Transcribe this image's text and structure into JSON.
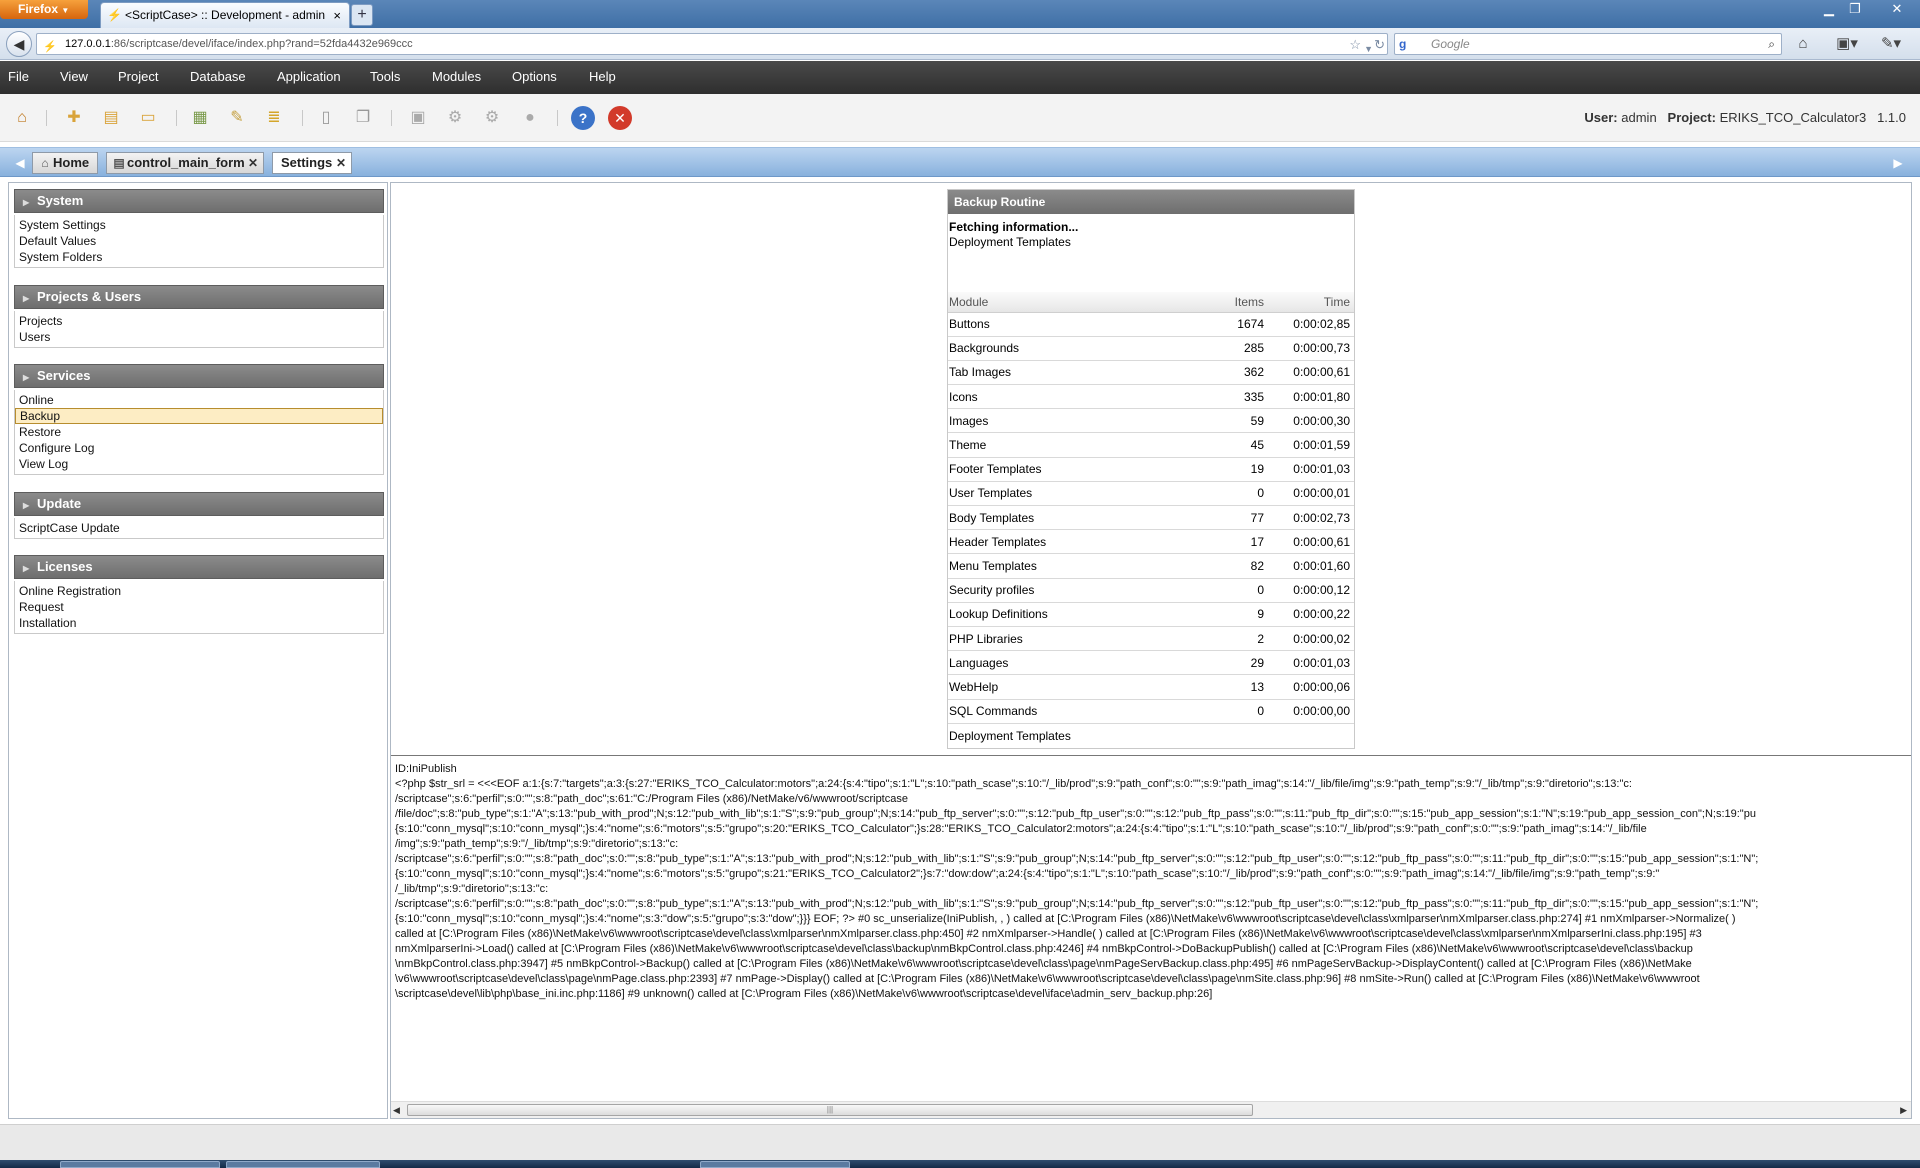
{
  "browser": {
    "menu_label": "Firefox",
    "tab_title": "<ScriptCase> :: Development - admin",
    "new_tab": "+",
    "url_host": "127.0.0.1",
    "url_rest": ":86/scriptcase/devel/iface/index.php?rand=52fda4432e969ccc",
    "search_placeholder": "Google"
  },
  "menu": [
    "File",
    "View",
    "Project",
    "Database",
    "Application",
    "Tools",
    "Modules",
    "Options",
    "Help"
  ],
  "user": {
    "user_label": "User:",
    "user_name": "admin",
    "project_label": "Project:",
    "project_name": "ERIKS_TCO_Calculator3",
    "version": "1.1.0"
  },
  "tabs": [
    {
      "label": "Home",
      "icon": "home-icon"
    },
    {
      "label": "control_main_form",
      "icon": "form-icon"
    },
    {
      "label": "Settings",
      "icon": "none"
    }
  ],
  "sidebar": {
    "sections": [
      {
        "title": "System",
        "items": [
          "System Settings",
          "Default Values",
          "System Folders"
        ]
      },
      {
        "title": "Projects & Users",
        "items": [
          "Projects",
          "Users"
        ]
      },
      {
        "title": "Services",
        "items": [
          "Online",
          "Backup",
          "Restore",
          "Configure Log",
          "View Log"
        ]
      },
      {
        "title": "Update",
        "items": [
          "ScriptCase Update"
        ]
      },
      {
        "title": "Licenses",
        "items": [
          "Online Registration",
          "Request",
          "Installation"
        ]
      }
    ],
    "selected": "Backup"
  },
  "backup": {
    "title": "Backup Routine",
    "status": "Fetching information...",
    "current": "Deployment Templates",
    "columns": [
      "Module",
      "Items",
      "Time"
    ],
    "rows": [
      [
        "Buttons",
        "1674",
        "0:00:02,85"
      ],
      [
        "Backgrounds",
        "285",
        "0:00:00,73"
      ],
      [
        "Tab Images",
        "362",
        "0:00:00,61"
      ],
      [
        "Icons",
        "335",
        "0:00:01,80"
      ],
      [
        "Images",
        "59",
        "0:00:00,30"
      ],
      [
        "Theme",
        "45",
        "0:00:01,59"
      ],
      [
        "Footer Templates",
        "19",
        "0:00:01,03"
      ],
      [
        "User Templates",
        "0",
        "0:00:00,01"
      ],
      [
        "Body Templates",
        "77",
        "0:00:02,73"
      ],
      [
        "Header Templates",
        "17",
        "0:00:00,61"
      ],
      [
        "Menu Templates",
        "82",
        "0:00:01,60"
      ],
      [
        "Security profiles",
        "0",
        "0:00:00,12"
      ],
      [
        "Lookup Definitions",
        "9",
        "0:00:00,22"
      ],
      [
        "PHP Libraries",
        "2",
        "0:00:00,02"
      ],
      [
        "Languages",
        "29",
        "0:00:01,03"
      ],
      [
        "WebHelp",
        "13",
        "0:00:00,06"
      ],
      [
        "SQL Commands",
        "0",
        "0:00:00,00"
      ],
      [
        "Deployment Templates",
        "",
        ""
      ]
    ]
  },
  "log": {
    "lines": [
      "ID:IniPublish",
      "<?php $str_srl = <<<EOF a:1:{s:7:\"targets\";a:3:{s:27:\"ERIKS_TCO_Calculator:motors\";a:24:{s:4:\"tipo\";s:1:\"L\";s:10:\"path_scase\";s:10:\"/_lib/prod\";s:9:\"path_conf\";s:0:\"\";s:9:\"path_imag\";s:14:\"/_lib/file/img\";s:9:\"path_temp\";s:9:\"/_lib/tmp\";s:9:\"diretorio\";s:13:\"c:",
      "/scriptcase\";s:6:\"perfil\";s:0:\"\";s:8:\"path_doc\";s:61:\"C:/Program Files (x86)/NetMake/v6/wwwroot/scriptcase",
      "/file/doc\";s:8:\"pub_type\";s:1:\"A\";s:13:\"pub_with_prod\";N;s:12:\"pub_with_lib\";s:1:\"S\";s:9:\"pub_group\";N;s:14:\"pub_ftp_server\";s:0:\"\";s:12:\"pub_ftp_user\";s:0:\"\";s:12:\"pub_ftp_pass\";s:0:\"\";s:11:\"pub_ftp_dir\";s:0:\"\";s:15:\"pub_app_session\";s:1:\"N\";s:19:\"pub_app_session_con\";N;s:19:\"pu",
      "{s:10:\"conn_mysql\";s:10:\"conn_mysql\";}s:4:\"nome\";s:6:\"motors\";s:5:\"grupo\";s:20:\"ERIKS_TCO_Calculator\";}s:28:\"ERIKS_TCO_Calculator2:motors\";a:24:{s:4:\"tipo\";s:1:\"L\";s:10:\"path_scase\";s:10:\"/_lib/prod\";s:9:\"path_conf\";s:0:\"\";s:9:\"path_imag\";s:14:\"/_lib/file",
      "/img\";s:9:\"path_temp\";s:9:\"/_lib/tmp\";s:9:\"diretorio\";s:13:\"c:",
      "/scriptcase\";s:6:\"perfil\";s:0:\"\";s:8:\"path_doc\";s:0:\"\";s:8:\"pub_type\";s:1:\"A\";s:13:\"pub_with_prod\";N;s:12:\"pub_with_lib\";s:1:\"S\";s:9:\"pub_group\";N;s:14:\"pub_ftp_server\";s:0:\"\";s:12:\"pub_ftp_user\";s:0:\"\";s:12:\"pub_ftp_pass\";s:0:\"\";s:11:\"pub_ftp_dir\";s:0:\"\";s:15:\"pub_app_session\";s:1:\"N\";",
      "{s:10:\"conn_mysql\";s:10:\"conn_mysql\";}s:4:\"nome\";s:6:\"motors\";s:5:\"grupo\";s:21:\"ERIKS_TCO_Calculator2\";}s:7:\"dow:dow\";a:24:{s:4:\"tipo\";s:1:\"L\";s:10:\"path_scase\";s:10:\"/_lib/prod\";s:9:\"path_conf\";s:0:\"\";s:9:\"path_imag\";s:14:\"/_lib/file/img\";s:9:\"path_temp\";s:9:\"",
      "/_lib/tmp\";s:9:\"diretorio\";s:13:\"c:",
      "/scriptcase\";s:6:\"perfil\";s:0:\"\";s:8:\"path_doc\";s:0:\"\";s:8:\"pub_type\";s:1:\"A\";s:13:\"pub_with_prod\";N;s:12:\"pub_with_lib\";s:1:\"S\";s:9:\"pub_group\";N;s:14:\"pub_ftp_server\";s:0:\"\";s:12:\"pub_ftp_user\";s:0:\"\";s:12:\"pub_ftp_pass\";s:0:\"\";s:11:\"pub_ftp_dir\";s:0:\"\";s:15:\"pub_app_session\";s:1:\"N\";",
      "{s:10:\"conn_mysql\";s:10:\"conn_mysql\";}s:4:\"nome\";s:3:\"dow\";s:5:\"grupo\";s:3:\"dow\";}}} EOF; ?> #0 sc_unserialize(IniPublish, , ) called at [C:\\Program Files (x86)\\NetMake\\v6\\wwwroot\\scriptcase\\devel\\class\\xmlparser\\nmXmlparser.class.php:274] #1 nmXmlparser->Normalize( )",
      "called at [C:\\Program Files (x86)\\NetMake\\v6\\wwwroot\\scriptcase\\devel\\class\\xmlparser\\nmXmlparser.class.php:450] #2 nmXmlparser->Handle( ) called at [C:\\Program Files (x86)\\NetMake\\v6\\wwwroot\\scriptcase\\devel\\class\\xmlparser\\nmXmlparserIni.class.php:195] #3",
      "nmXmlparserIni->Load() called at [C:\\Program Files (x86)\\NetMake\\v6\\wwwroot\\scriptcase\\devel\\class\\backup\\nmBkpControl.class.php:4246] #4 nmBkpControl->DoBackupPublish() called at [C:\\Program Files (x86)\\NetMake\\v6\\wwwroot\\scriptcase\\devel\\class\\backup",
      "\\nmBkpControl.class.php:3947] #5 nmBkpControl->Backup() called at [C:\\Program Files (x86)\\NetMake\\v6\\wwwroot\\scriptcase\\devel\\class\\page\\nmPageServBackup.class.php:495] #6 nmPageServBackup->DisplayContent() called at [C:\\Program Files (x86)\\NetMake",
      "\\v6\\wwwroot\\scriptcase\\devel\\class\\page\\nmPage.class.php:2393] #7 nmPage->Display() called at [C:\\Program Files (x86)\\NetMake\\v6\\wwwroot\\scriptcase\\devel\\class\\page\\nmSite.class.php:96] #8 nmSite->Run() called at [C:\\Program Files (x86)\\NetMake\\v6\\wwwroot",
      "\\scriptcase\\devel\\lib\\php\\base_ini.inc.php:1186] #9 unknown() called at [C:\\Program Files (x86)\\NetMake\\v6\\wwwroot\\scriptcase\\devel\\iface\\admin_serv_backup.php:26]"
    ]
  },
  "colors": {
    "menubar": "#3a3a3a",
    "section_header": "#7b7b7b",
    "tabstrip": "#9fc0e6",
    "selected_item": "#fdedc4"
  }
}
